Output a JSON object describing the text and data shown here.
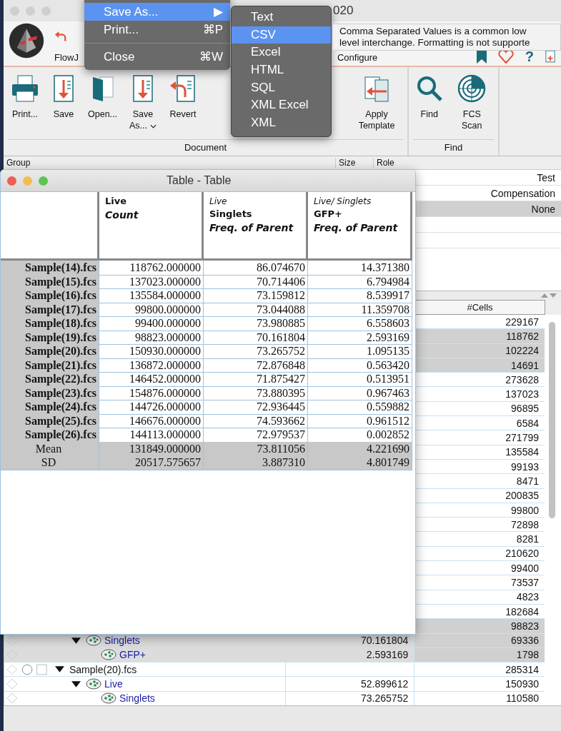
{
  "window": {
    "title": "020"
  },
  "ribbon_tabs": [
    {
      "label": "FlowJ"
    },
    {
      "label": "Configure"
    }
  ],
  "help_icon": {
    "text": "?"
  },
  "ribbon_groups": [
    {
      "label": "Document",
      "buttons": [
        {
          "kind": "print",
          "label": "Print..."
        },
        {
          "kind": "save",
          "label": "Save"
        },
        {
          "kind": "open",
          "label": "Open..."
        },
        {
          "kind": "save",
          "label": "Save As...",
          "dropdown": true
        },
        {
          "kind": "revert",
          "label": "Revert"
        },
        {
          "kind": "template",
          "label": "Apply Template"
        }
      ]
    },
    {
      "label": "Find",
      "buttons": [
        {
          "kind": "find",
          "label": "Find"
        },
        {
          "kind": "scan",
          "label": "FCS Scan"
        }
      ]
    }
  ],
  "group_table": {
    "columns": [
      "Group",
      "Size",
      "Role"
    ],
    "rows": [
      {
        "role": "Test",
        "selected": false
      },
      {
        "role": "Compensation",
        "selected": false
      },
      {
        "role": "None",
        "selected": true
      }
    ]
  },
  "samples_table": {
    "columns": [
      "#Cells"
    ],
    "rows": [
      {
        "cells": "229167",
        "selected": false
      },
      {
        "cells": "118762",
        "selected": true
      },
      {
        "cells": "102224",
        "selected": true
      },
      {
        "cells": "14691",
        "selected": true
      },
      {
        "cells": "273628",
        "selected": false
      },
      {
        "cells": "137023",
        "selected": false
      },
      {
        "cells": "96895",
        "selected": false
      },
      {
        "cells": "6584",
        "selected": false
      },
      {
        "cells": "271799",
        "selected": false
      },
      {
        "cells": "135584",
        "selected": false
      },
      {
        "cells": "99193",
        "selected": false
      },
      {
        "cells": "8471",
        "selected": false
      },
      {
        "cells": "200835",
        "selected": false
      },
      {
        "cells": "99800",
        "selected": false
      },
      {
        "cells": "72898",
        "selected": false
      },
      {
        "cells": "8281",
        "selected": false
      },
      {
        "cells": "210620",
        "selected": false
      },
      {
        "cells": "99400",
        "selected": false
      },
      {
        "cells": "73537",
        "selected": false
      },
      {
        "cells": "4823",
        "selected": false
      },
      {
        "cells": "182684",
        "selected": false
      },
      {
        "cells": "98823",
        "selected": true,
        "children": [
          {
            "kind": "gate",
            "name": "Singlets",
            "statistic": "70.161804",
            "cells": "69336",
            "selected": true,
            "expanded": true,
            "children": [
              {
                "kind": "gate",
                "name": "GFP+",
                "statistic": "2.593169",
                "cells": "1798",
                "selected": true
              }
            ]
          }
        ]
      },
      {
        "kind": "sample",
        "name": "Sample(20).fcs",
        "cells": "285314",
        "selected": false,
        "expanded": true,
        "children": [
          {
            "kind": "gate",
            "name": "Live",
            "statistic": "52.899612",
            "cells": "150930",
            "selected": false,
            "expanded": true,
            "children": [
              {
                "kind": "gate",
                "name": "Singlets",
                "statistic": "73.265752",
                "cells": "110580",
                "selected": false
              }
            ]
          }
        ]
      }
    ]
  },
  "table_window": {
    "title": "Table - Table",
    "columns": [
      {
        "lines": [
          {
            "kind": "name",
            "text": "Live"
          },
          {
            "kind": "stat",
            "text": "Count"
          }
        ]
      },
      {
        "lines": [
          {
            "kind": "path",
            "text": "Live"
          },
          {
            "kind": "name",
            "text": "Singlets"
          },
          {
            "kind": "stat",
            "text": "Freq. of Parent"
          }
        ]
      },
      {
        "lines": [
          {
            "kind": "path",
            "text": "Live/ Singlets"
          },
          {
            "kind": "name",
            "text": "GFP+"
          },
          {
            "kind": "stat",
            "text": "Freq. of Parent"
          }
        ]
      }
    ],
    "rows": [
      {
        "kind": "sample",
        "label": "Sample(14).fcs",
        "values": [
          "118762.000000",
          "86.074670",
          "14.371380"
        ]
      },
      {
        "kind": "sample",
        "label": "Sample(15).fcs",
        "values": [
          "137023.000000",
          "70.714406",
          "6.794984"
        ]
      },
      {
        "kind": "sample",
        "label": "Sample(16).fcs",
        "values": [
          "135584.000000",
          "73.159812",
          "8.539917"
        ]
      },
      {
        "kind": "sample",
        "label": "Sample(17).fcs",
        "values": [
          "99800.000000",
          "73.044088",
          "11.359708"
        ]
      },
      {
        "kind": "sample",
        "label": "Sample(18).fcs",
        "values": [
          "99400.000000",
          "73.980885",
          "6.558603"
        ]
      },
      {
        "kind": "sample",
        "label": "Sample(19).fcs",
        "values": [
          "98823.000000",
          "70.161804",
          "2.593169"
        ]
      },
      {
        "kind": "sample",
        "label": "Sample(20).fcs",
        "values": [
          "150930.000000",
          "73.265752",
          "1.095135"
        ]
      },
      {
        "kind": "sample",
        "label": "Sample(21).fcs",
        "values": [
          "136872.000000",
          "72.876848",
          "0.563420"
        ]
      },
      {
        "kind": "sample",
        "label": "Sample(22).fcs",
        "values": [
          "146452.000000",
          "71.875427",
          "0.513951"
        ]
      },
      {
        "kind": "sample",
        "label": "Sample(23).fcs",
        "values": [
          "154876.000000",
          "73.880395",
          "0.967463"
        ]
      },
      {
        "kind": "sample",
        "label": "Sample(24).fcs",
        "values": [
          "144726.000000",
          "72.936445",
          "0.559882"
        ]
      },
      {
        "kind": "sample",
        "label": "Sample(25).fcs",
        "values": [
          "146676.000000",
          "74.593662",
          "0.961512"
        ]
      },
      {
        "kind": "sample",
        "label": "Sample(26).fcs",
        "values": [
          "144113.000000",
          "72.979537",
          "0.002852"
        ]
      },
      {
        "kind": "summary",
        "label": "Mean",
        "values": [
          "131849.000000",
          "73.811056",
          "4.221690"
        ]
      },
      {
        "kind": "summary",
        "label": "SD",
        "values": [
          "20517.575657",
          "3.887310",
          "4.801749"
        ]
      }
    ]
  },
  "file_menu": {
    "items": [
      {
        "kind": "item",
        "label": "Save As...",
        "shortcut": "▶",
        "selected": true
      },
      {
        "kind": "item",
        "label": "Print...",
        "shortcut": "⌘P",
        "selected": false
      },
      {
        "kind": "separator"
      },
      {
        "kind": "item",
        "label": "Close",
        "shortcut": "⌘W",
        "selected": false
      }
    ]
  },
  "save_as_submenu": {
    "items": [
      {
        "label": "Text",
        "selected": false
      },
      {
        "label": "CSV",
        "selected": true
      },
      {
        "label": "Excel",
        "selected": false
      },
      {
        "label": "HTML",
        "selected": false
      },
      {
        "label": "SQL",
        "selected": false
      },
      {
        "label": "XML Excel",
        "selected": false
      },
      {
        "label": "XML",
        "selected": false
      }
    ]
  },
  "tooltip": {
    "text": "Comma Separated Values is a common low\nlevel interchange. Formatting is not supporte"
  }
}
